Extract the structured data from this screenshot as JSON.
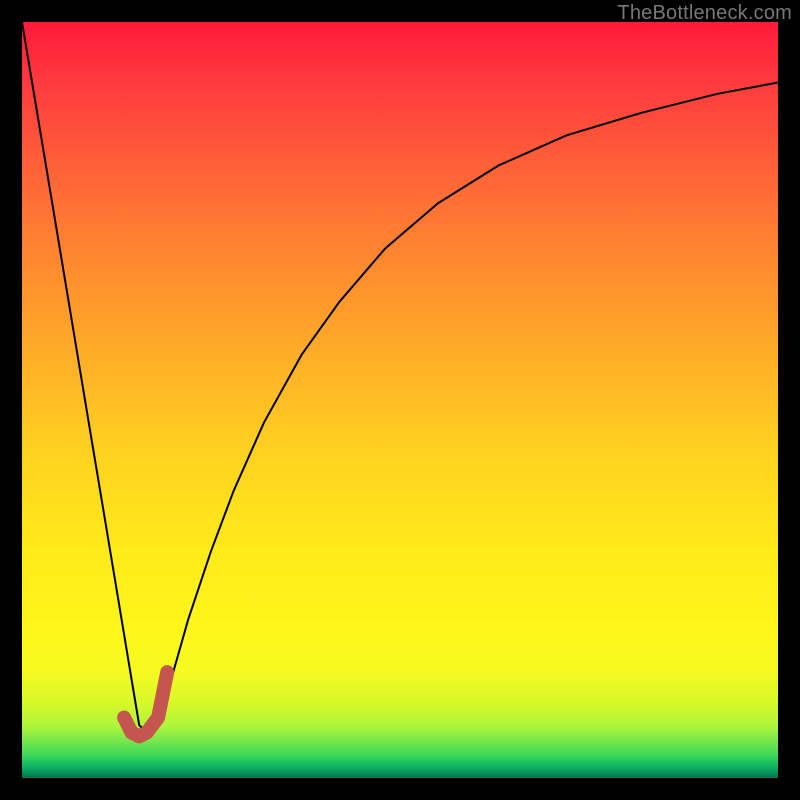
{
  "watermark": "TheBottleneck.com",
  "chart_data": {
    "type": "line",
    "title": "",
    "xlabel": "",
    "ylabel": "",
    "xlim": [
      0,
      100
    ],
    "ylim": [
      0,
      100
    ],
    "series": [
      {
        "name": "bottleneck-curve",
        "x": [
          0,
          3,
          6,
          9,
          11,
          13,
          14.5,
          15.5,
          16.5,
          18,
          20,
          22,
          25,
          28,
          32,
          37,
          42,
          48,
          55,
          63,
          72,
          82,
          92,
          100
        ],
        "y": [
          100,
          82,
          64,
          46,
          34,
          22,
          13,
          7,
          6,
          8,
          14,
          21,
          30,
          38,
          47,
          56,
          63,
          70,
          76,
          81,
          85,
          88,
          90.5,
          92
        ],
        "stroke": "#000000",
        "stroke_width": 2
      },
      {
        "name": "highlight-segment",
        "x": [
          13.5,
          14.5,
          15.5,
          16.5,
          18,
          19.2
        ],
        "y": [
          8,
          6,
          5.5,
          6,
          8,
          14
        ],
        "stroke": "#c5564f",
        "stroke_width": 14
      }
    ]
  }
}
